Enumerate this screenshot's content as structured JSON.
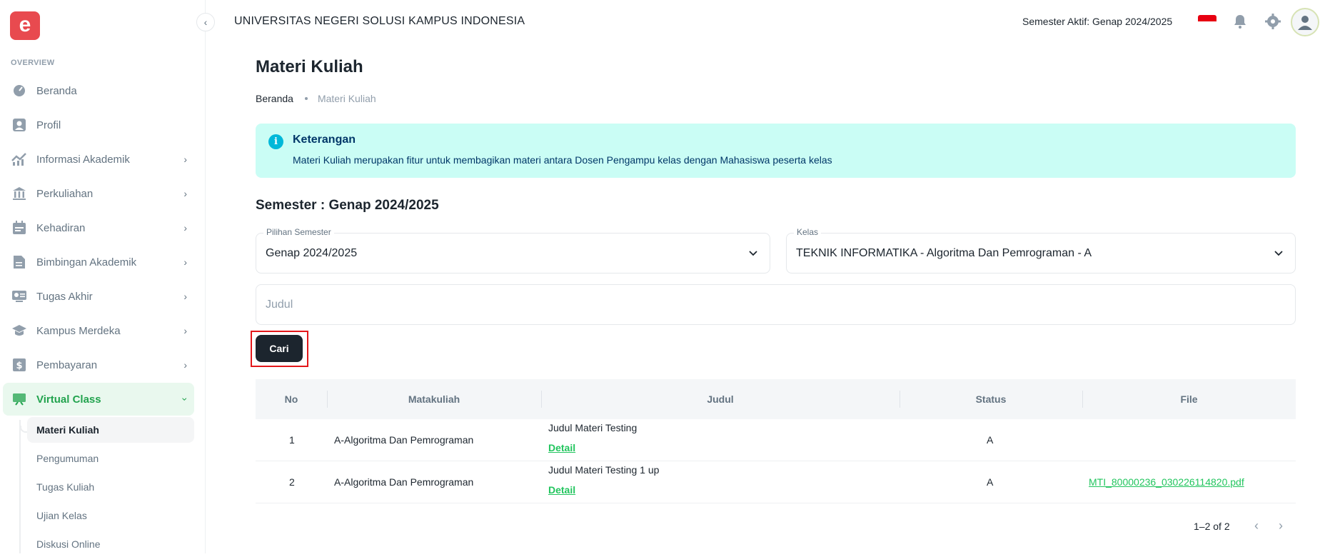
{
  "app": {
    "logo_letter": "e",
    "university": "UNIVERSITAS NEGERI SOLUSI KAMPUS INDONESIA",
    "active_semester": "Semester Aktif: Genap 2024/2025",
    "accent_color": "#22a34e"
  },
  "sidebar": {
    "section": "OVERVIEW",
    "items": [
      {
        "label": "Beranda",
        "icon": "dashboard-icon"
      },
      {
        "label": "Profil",
        "icon": "user-icon"
      },
      {
        "label": "Informasi Akademik",
        "icon": "chart-icon"
      },
      {
        "label": "Perkuliahan",
        "icon": "institution-icon"
      },
      {
        "label": "Kehadiran",
        "icon": "calendar-icon"
      },
      {
        "label": "Bimbingan Akademik",
        "icon": "document-icon"
      },
      {
        "label": "Tugas Akhir",
        "icon": "id-card-icon"
      },
      {
        "label": "Kampus Merdeka",
        "icon": "graduation-cap-icon"
      },
      {
        "label": "Pembayaran",
        "icon": "dollar-icon"
      },
      {
        "label": "Virtual Class",
        "icon": "board-icon"
      }
    ],
    "sub_items": [
      "Materi Kuliah",
      "Pengumuman",
      "Tugas Kuliah",
      "Ujian Kelas",
      "Diskusi Online"
    ]
  },
  "page": {
    "title": "Materi Kuliah",
    "breadcrumb": [
      "Beranda",
      "Materi Kuliah"
    ]
  },
  "alert": {
    "title": "Keterangan",
    "text": "Materi Kuliah merupakan fitur untuk membagikan materi antara Dosen Pengampu kelas dengan Mahasiswa peserta kelas"
  },
  "filters": {
    "heading": "Semester : Genap 2024/2025",
    "semester_label": "Pilihan Semester",
    "semester_value": "Genap 2024/2025",
    "kelas_label": "Kelas",
    "kelas_value": "TEKNIK INFORMATIKA - Algoritma Dan Pemrograman - A",
    "judul_placeholder": "Judul",
    "search_button": "Cari"
  },
  "table": {
    "columns": [
      "No",
      "Matakuliah",
      "Judul",
      "Status",
      "File"
    ],
    "rows": [
      {
        "no": "1",
        "matakuliah": "A-Algoritma Dan Pemrograman",
        "judul": "Judul Materi Testing",
        "detail": "Detail",
        "status": "A",
        "file": ""
      },
      {
        "no": "2",
        "matakuliah": "A-Algoritma Dan Pemrograman",
        "judul": "Judul Materi Testing 1 up",
        "detail": "Detail",
        "status": "A",
        "file": "MTI_80000236_030226114820.pdf"
      }
    ],
    "pagination": "1–2 of 2"
  }
}
